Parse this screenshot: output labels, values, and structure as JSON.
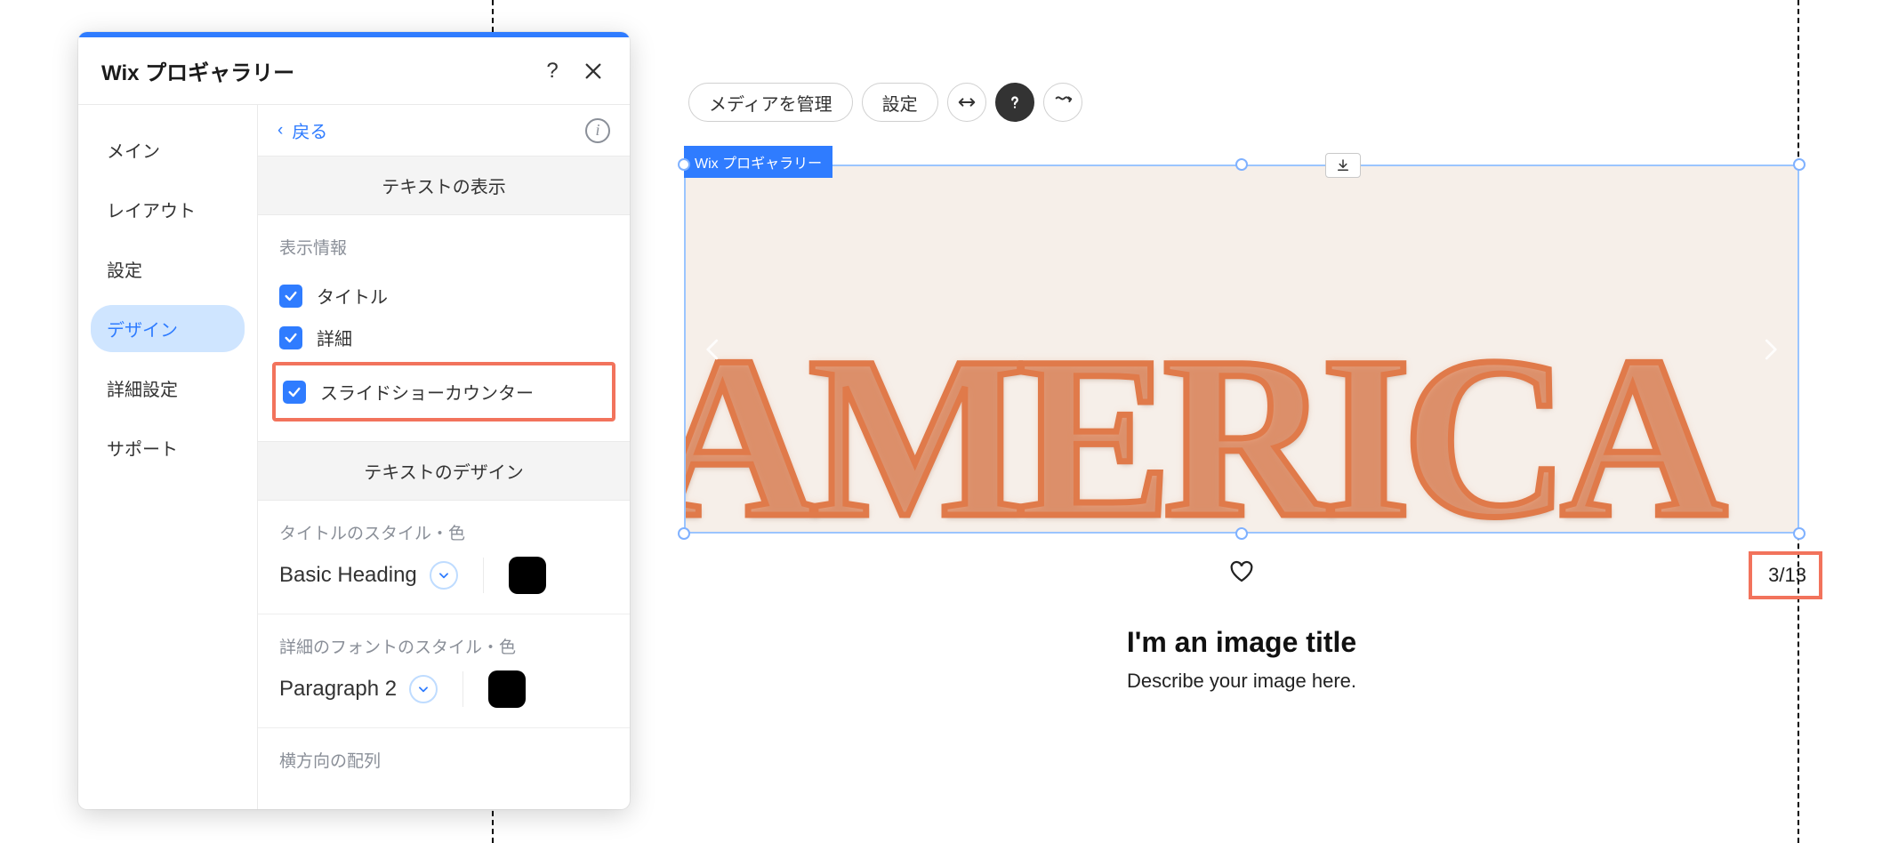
{
  "panel": {
    "title": "Wix プロギャラリー",
    "help": "?",
    "back": "戻る",
    "sidebar": [
      {
        "label": "メイン"
      },
      {
        "label": "レイアウト"
      },
      {
        "label": "設定"
      },
      {
        "label": "デザイン",
        "active": true
      },
      {
        "label": "詳細設定"
      },
      {
        "label": "サポート"
      }
    ],
    "text_display_header": "テキストの表示",
    "display_info_label": "表示情報",
    "checks": {
      "title": "タイトル",
      "details": "詳細",
      "slideshow_counter": "スライドショーカウンター"
    },
    "text_design_header": "テキストのデザイン",
    "title_style_label": "タイトルのスタイル・色",
    "title_style_value": "Basic Heading",
    "detail_style_label": "詳細のフォントのスタイル・色",
    "detail_style_value": "Paragraph 2",
    "horizontal_align_label": "横方向の配列"
  },
  "toolbar": {
    "manage_media": "メディアを管理",
    "settings": "設定"
  },
  "element_tag": "Wix プロギャラリー",
  "gallery": {
    "neon_text": "AMERICA",
    "counter": "3/13",
    "image_title": "I'm an image title",
    "image_desc": "Describe your image here."
  }
}
